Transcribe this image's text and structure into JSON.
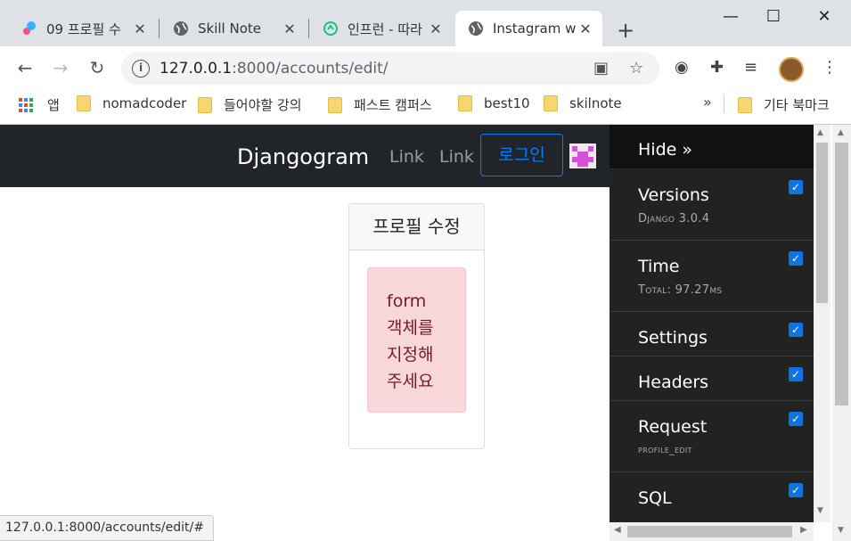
{
  "tabs": [
    {
      "title": "09 프로필 수",
      "icon": "colorful-logo-icon",
      "active": false
    },
    {
      "title": "Skill Note",
      "icon": "globe-icon",
      "active": false
    },
    {
      "title": "인프런 - 따라",
      "icon": "inflearn-icon",
      "active": false
    },
    {
      "title": "Instagram w",
      "icon": "globe-icon",
      "active": true
    }
  ],
  "address_bar": {
    "host": "127.0.0.1",
    "rest": ":8000/accounts/edit/"
  },
  "bookmarks": {
    "apps_label": "앱",
    "items": [
      "nomadcoder",
      "들어야할 강의",
      "패스트 캠퍼스",
      "best10",
      "skilnote"
    ],
    "more": "»",
    "other": "기타 북마크"
  },
  "navbar": {
    "brand": "Djangogram",
    "links": [
      "Link",
      "Link"
    ],
    "login": "로그인"
  },
  "card": {
    "header": "프로필 수정",
    "alert_lines": [
      "form",
      "객체를",
      "지정해",
      "주세요"
    ]
  },
  "debug_toolbar": {
    "hide": "Hide »",
    "panels": [
      {
        "title": "Versions",
        "sub": "Django 3.0.4",
        "checked": true
      },
      {
        "title": "Time",
        "sub": "Total: 97.27ms",
        "checked": true
      },
      {
        "title": "Settings",
        "sub": "",
        "checked": true
      },
      {
        "title": "Headers",
        "sub": "",
        "checked": true
      },
      {
        "title": "Request",
        "sub": "profile_edit",
        "checked": true
      },
      {
        "title": "SQL",
        "sub": "",
        "checked": true
      }
    ]
  },
  "status_url": "127.0.0.1:8000/accounts/edit/#"
}
